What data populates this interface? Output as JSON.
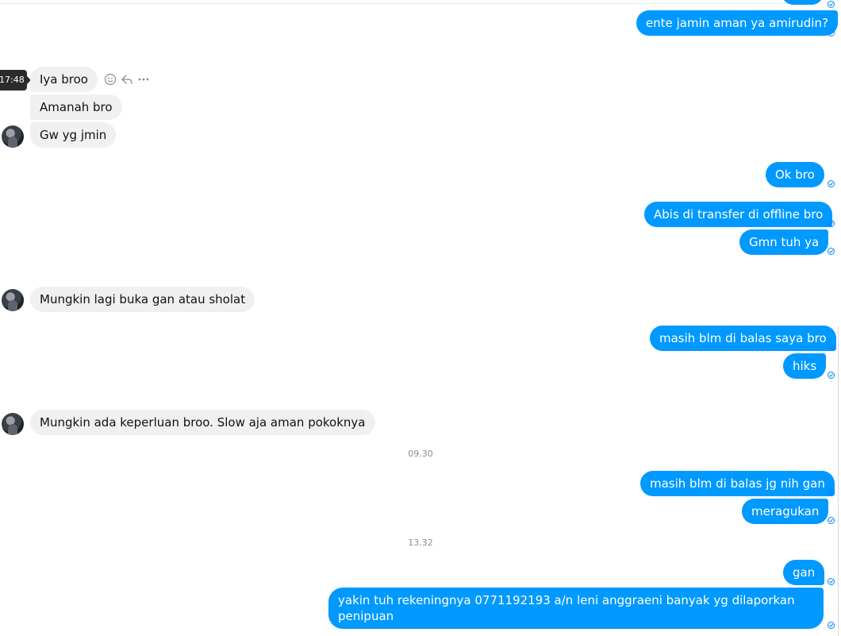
{
  "hover": {
    "time": "17:48"
  },
  "messages": {
    "m0": "ente jamin aman ya amirudin?",
    "m1": "Iya broo",
    "m2": "Amanah bro",
    "m3": "Gw yg jmin",
    "m4": "Ok bro",
    "m5": "Abis di transfer di offline bro",
    "m6": "Gmn tuh ya",
    "m7": "Mungkin lagi buka gan atau sholat",
    "m8": "masih blm di balas saya bro",
    "m9": "hiks",
    "m10": "Mungkin ada keperluan broo. Slow aja aman pokoknya",
    "m11": "masih blm di balas jg nih gan",
    "m12": "meragukan",
    "m13": "gan",
    "m14": "yakin tuh rekeningnya 0771192193 a/n leni anggraeni banyak yg dilaporkan penipuan"
  },
  "timestamps": {
    "t1": "09.30",
    "t2": "13.32"
  },
  "icons": {
    "react": "smiley-icon",
    "reply": "reply-arrow-icon",
    "more": "more-dots-icon",
    "seen": "sent-check-icon"
  },
  "colors": {
    "outgoing_bubble": "#0099ff",
    "incoming_bubble": "#f0f0f0",
    "seen_indicator": "#0084ff"
  }
}
